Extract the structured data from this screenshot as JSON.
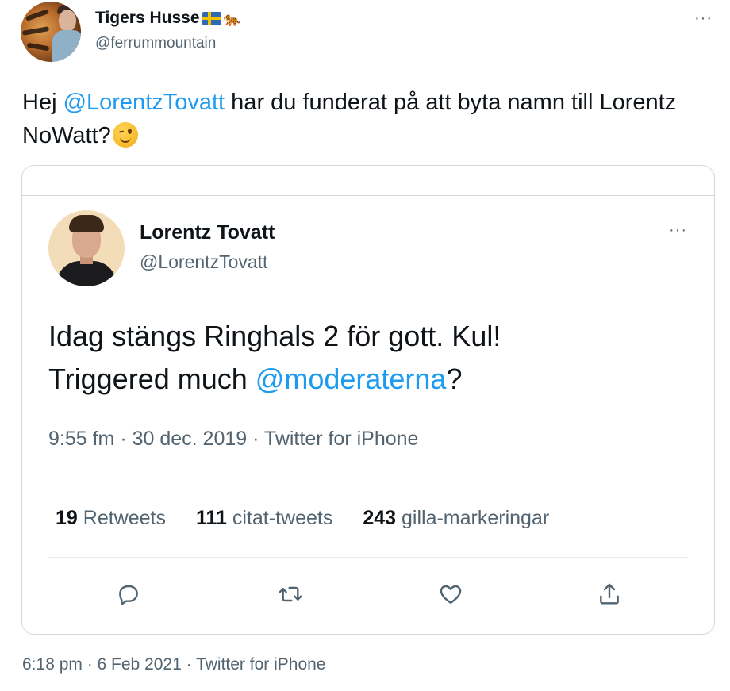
{
  "outer_tweet": {
    "display_name": "Tigers Husse",
    "flag_emoji": "swedish-flag",
    "tiger_emoji": "🐅",
    "handle": "@ferrummountain",
    "more_label": "···",
    "text_prefix": "Hej ",
    "mention": "@LorentzTovatt",
    "text_suffix": " har du funderat på att byta namn till Lorentz NoWatt?",
    "emoji": "winking-face",
    "timestamp": "6:18 pm · 6 Feb 2021 · Twitter for iPhone"
  },
  "quoted_tweet": {
    "display_name": "Lorentz Tovatt",
    "handle": "@LorentzTovatt",
    "more_label": "···",
    "text_line1": "Idag stängs Ringhals 2 för gott. Kul!",
    "text_line2_prefix": "Triggered much ",
    "mention": "@moderaterna",
    "text_line2_suffix": "?",
    "timestamp": "9:55 fm · 30 dec. 2019 · Twitter for iPhone",
    "stats": {
      "retweets_count": "19",
      "retweets_label": "Retweets",
      "quotes_count": "111",
      "quotes_label": "citat-tweets",
      "likes_count": "243",
      "likes_label": "gilla-markeringar"
    },
    "actions": [
      "reply-icon",
      "retweet-icon",
      "like-icon",
      "share-icon"
    ]
  },
  "colors": {
    "link": "#1d9bf0",
    "secondary_text": "#536471",
    "border": "#cfd9de"
  }
}
